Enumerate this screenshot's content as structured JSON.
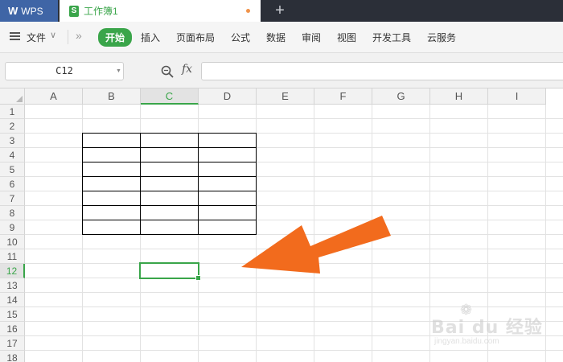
{
  "titlebar": {
    "app_label": "WPS",
    "doc_tab": "工作簿1",
    "new_tab_symbol": "+"
  },
  "menu": {
    "file_label": "文件",
    "more_symbol": "»",
    "items": [
      {
        "label": "开始",
        "active": true
      },
      {
        "label": "插入",
        "active": false
      },
      {
        "label": "页面布局",
        "active": false
      },
      {
        "label": "公式",
        "active": false
      },
      {
        "label": "数据",
        "active": false
      },
      {
        "label": "审阅",
        "active": false
      },
      {
        "label": "视图",
        "active": false
      },
      {
        "label": "开发工具",
        "active": false
      },
      {
        "label": "云服务",
        "active": false
      }
    ]
  },
  "formula_bar": {
    "name_box": "C12",
    "fx_label": "fx",
    "formula_value": ""
  },
  "sheet": {
    "columns": [
      "A",
      "B",
      "C",
      "D",
      "E",
      "F",
      "G",
      "H",
      "I"
    ],
    "rows": [
      "1",
      "2",
      "3",
      "4",
      "5",
      "6",
      "7",
      "8",
      "9",
      "10",
      "11",
      "12",
      "13",
      "14",
      "15",
      "16",
      "17",
      "18"
    ],
    "selected_cell": "C12",
    "selected_column": "C",
    "selected_row": "12",
    "bordered_range": "B3:D9"
  },
  "colors": {
    "accent_green": "#3aa54a",
    "arrow_orange": "#f26b1d",
    "wps_tab_blue": "#3f65a6",
    "titlebar_dark": "#2b2f38"
  },
  "watermark": {
    "brand": "Bai du 经验",
    "site": "jingyan.baidu.com"
  }
}
